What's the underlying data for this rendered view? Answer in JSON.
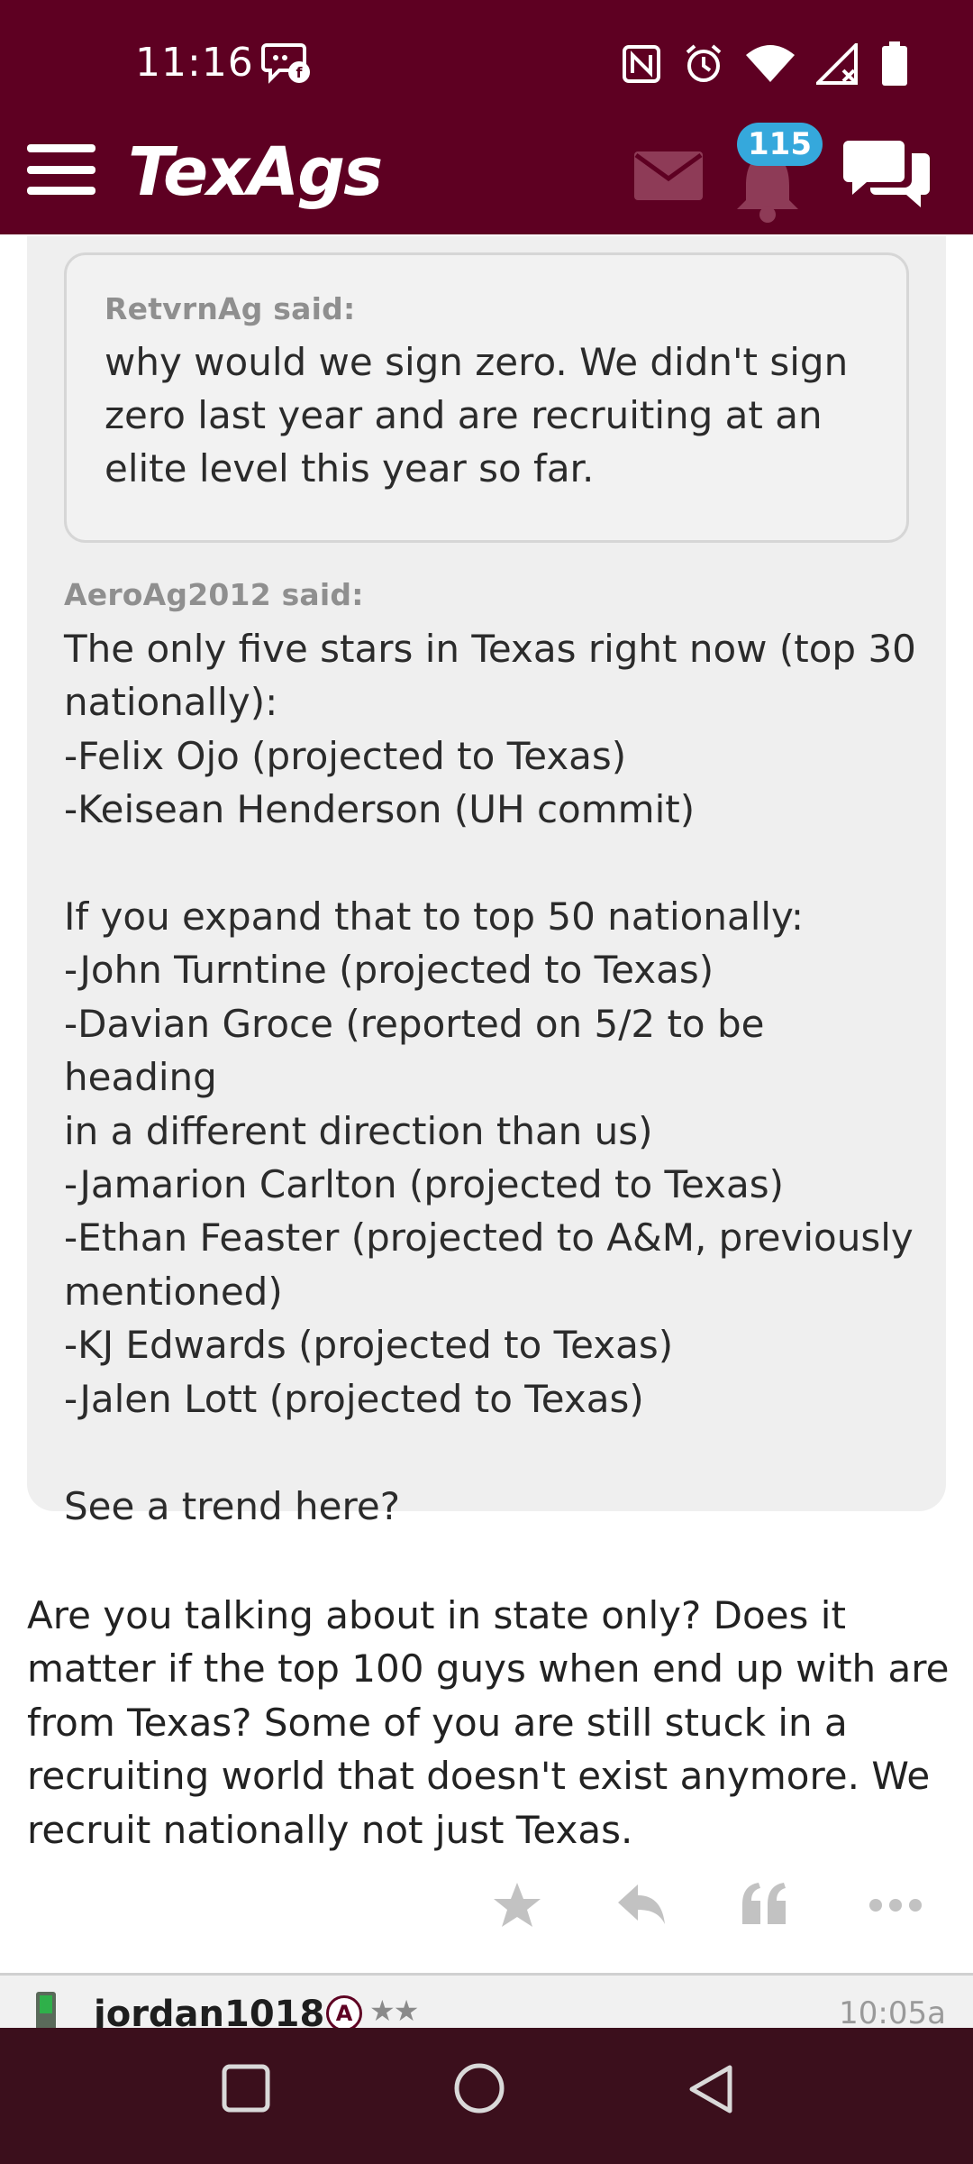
{
  "status_bar": {
    "time": "11:16",
    "icons": [
      "chat-bubble-notification-icon",
      "nfc-icon",
      "alarm-icon",
      "wifi-icon",
      "signal-no-service-icon",
      "battery-icon"
    ]
  },
  "header": {
    "logo": "TexAgs",
    "notification_count": "115",
    "icons": [
      "menu-icon",
      "mail-icon",
      "bell-icon",
      "chat-icon"
    ]
  },
  "post": {
    "inner_quote": {
      "author_label": "RetvrnAg said:",
      "text": "why would we sign zero. We didn't sign\nzero last year and are recruiting at an\nelite level this year so far."
    },
    "outer_quote": {
      "author_label": "AeroAg2012 said:",
      "text": "The only five stars in Texas right now (top 30\nnationally):\n-Felix Ojo (projected to Texas)\n-Keisean Henderson (UH commit)\n\nIf you expand that to top 50 nationally:\n-John Turntine (projected to Texas)\n-Davian Groce (reported on 5/2 to be heading\nin a different direction than us)\n-Jamarion Carlton (projected to Texas)\n-Ethan Feaster (projected to A&M, previously\nmentioned)\n-KJ Edwards (projected to Texas)\n-Jalen Lott (projected to Texas)\n\nSee a trend here?"
    },
    "body": "Are you talking about in state only? Does it matter if the top 100 guys when end up with are from Texas? Some of you are still stuck in a recruiting world that doesn't exist anymore. We recruit nationally not just Texas.",
    "actions": [
      "star-icon",
      "reply-icon",
      "quote-icon",
      "more-icon"
    ]
  },
  "next_post": {
    "username": "jordan1018",
    "rank_badge": "A",
    "stars": "★★",
    "time": "10:05a"
  },
  "nav_bar": {
    "buttons": [
      "recents-button",
      "home-button",
      "back-button"
    ]
  },
  "colors": {
    "brand": "#5e0022",
    "badge": "#35a8dc",
    "nav_bar": "#3b0f1c"
  }
}
